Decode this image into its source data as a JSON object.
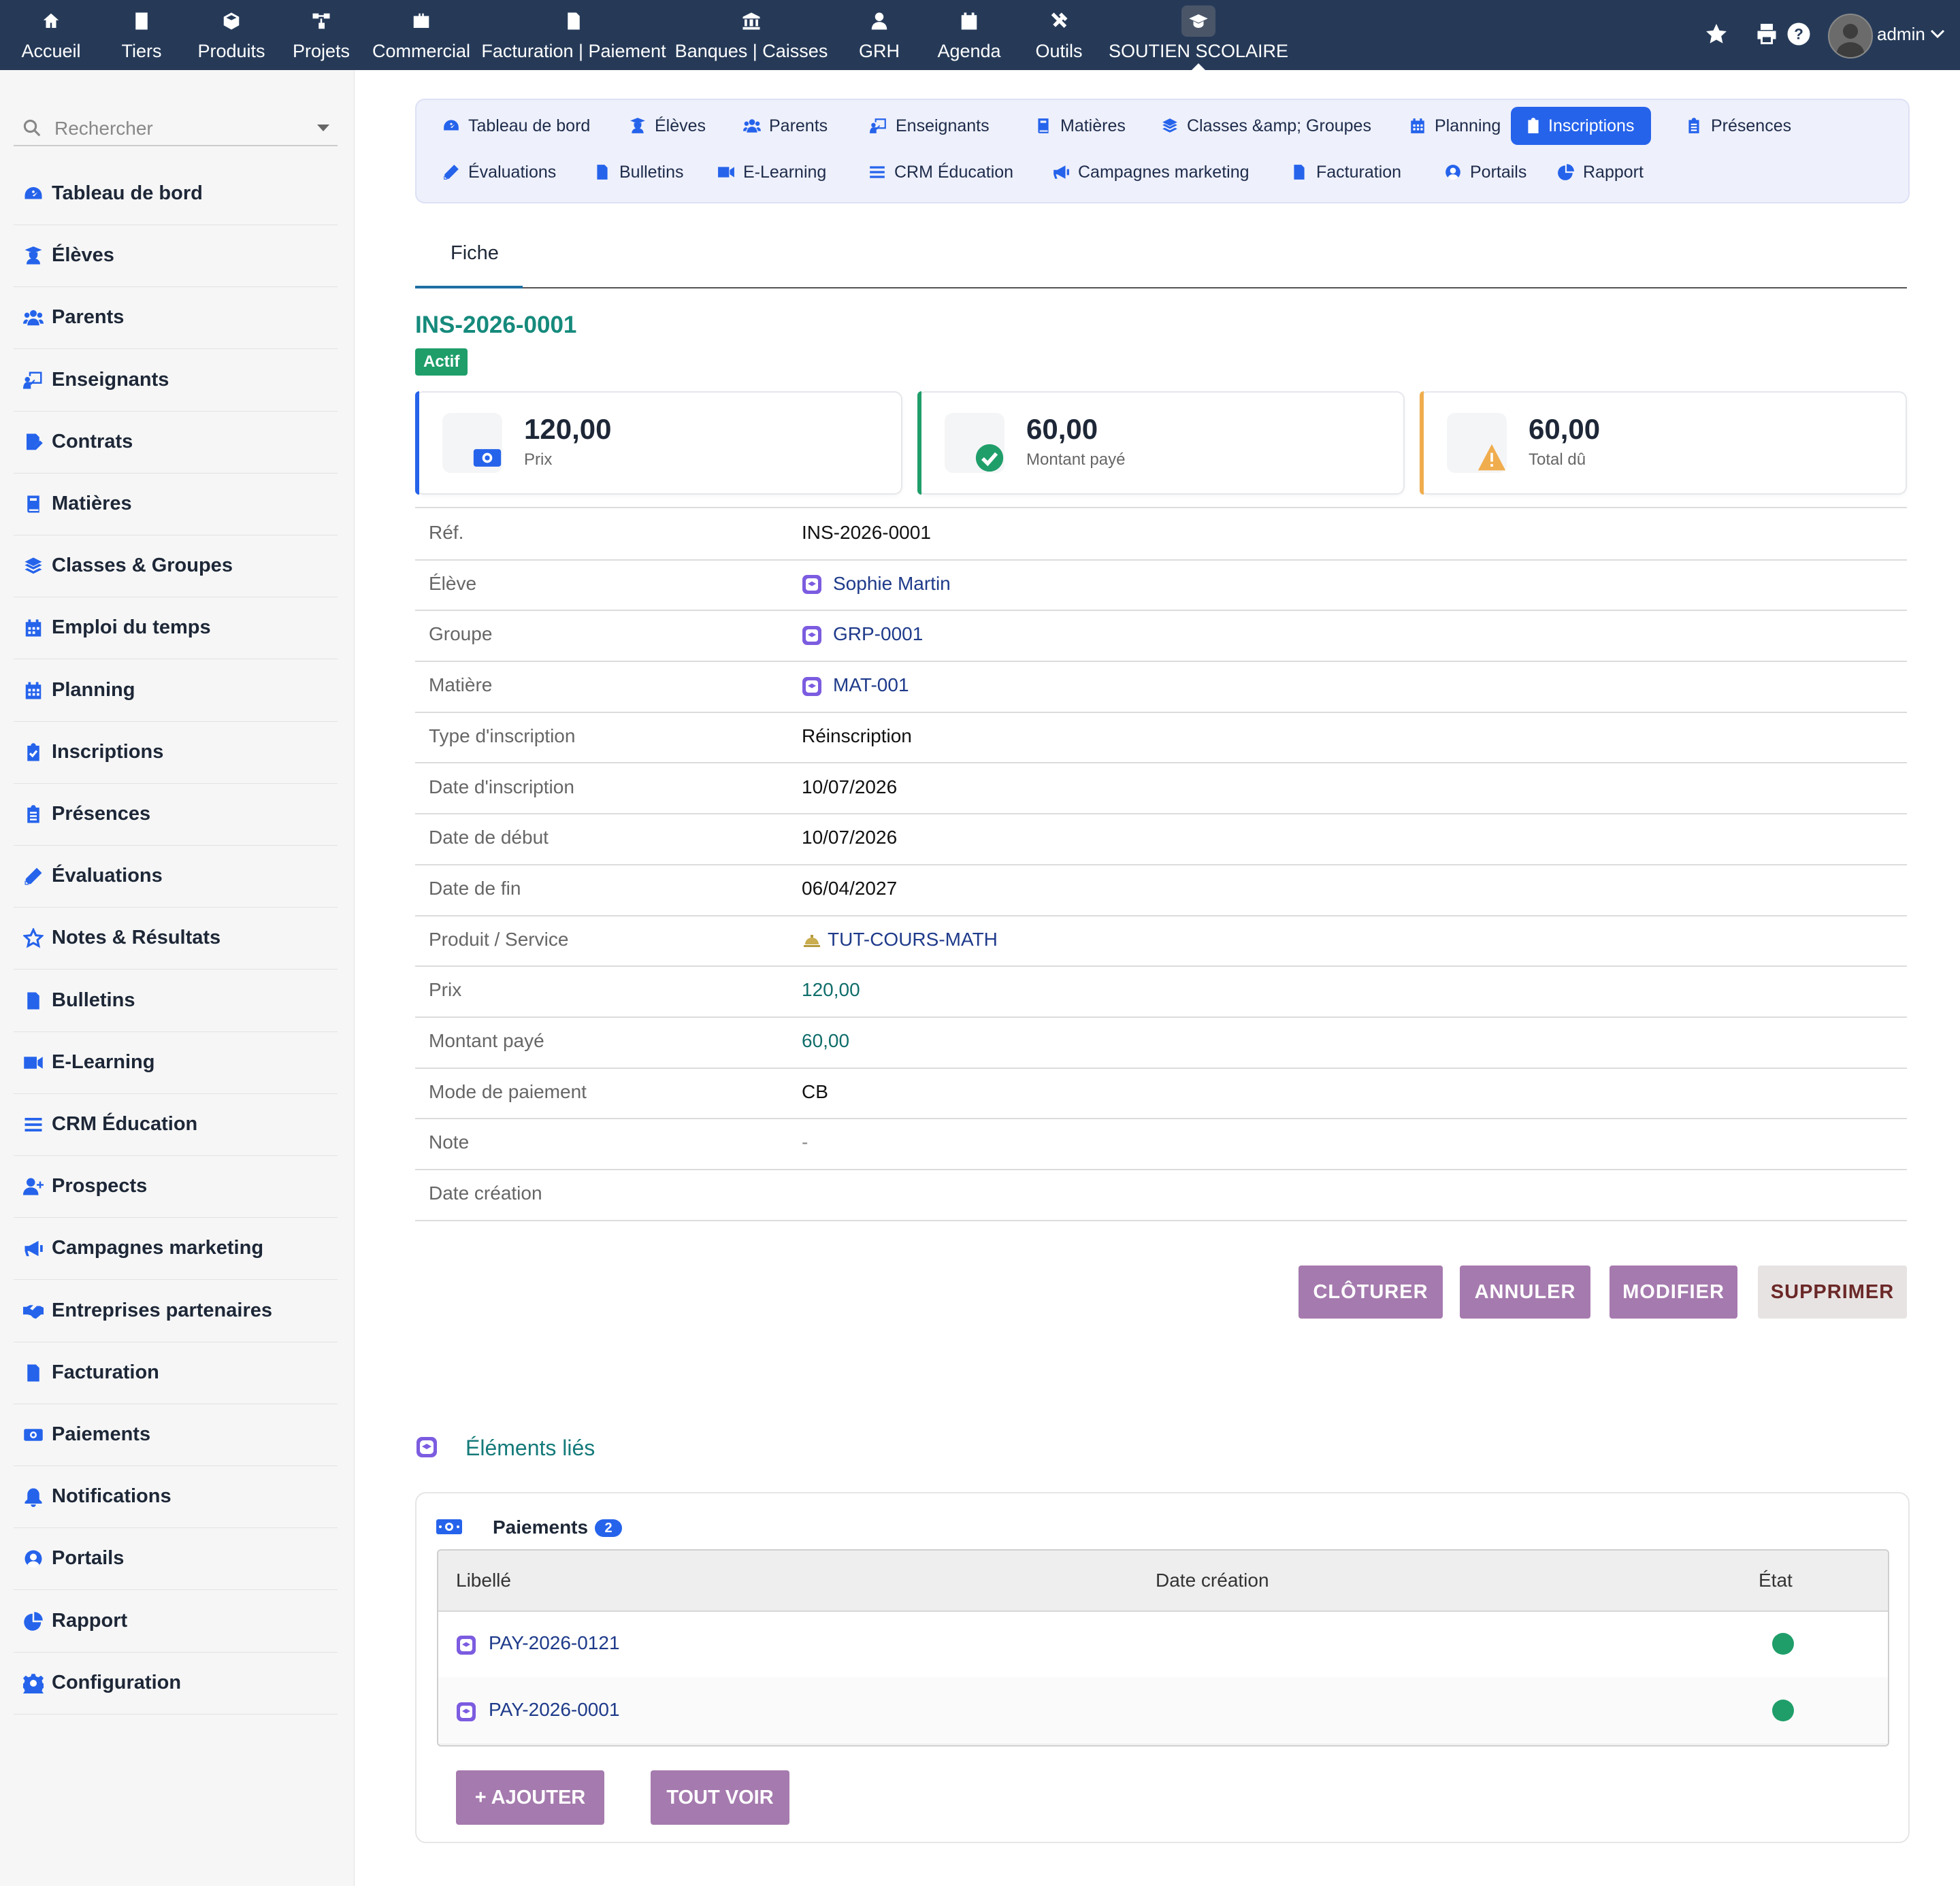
{
  "topnav": {
    "items": [
      {
        "label": "Accueil",
        "icon": "home-icon"
      },
      {
        "label": "Tiers",
        "icon": "building-icon"
      },
      {
        "label": "Produits",
        "icon": "cube-icon"
      },
      {
        "label": "Projets",
        "icon": "sitemap-icon"
      },
      {
        "label": "Commercial",
        "icon": "briefcase-icon"
      },
      {
        "label": "Facturation | Paiement",
        "icon": "invoice-icon"
      },
      {
        "label": "Banques | Caisses",
        "icon": "bank-icon"
      },
      {
        "label": "GRH",
        "icon": "user-tie-icon"
      },
      {
        "label": "Agenda",
        "icon": "calendar-icon"
      },
      {
        "label": "Outils",
        "icon": "tools-icon"
      },
      {
        "label": "SOUTIEN SCOLAIRE",
        "icon": "graduation-cap-icon"
      }
    ],
    "active_index": 10,
    "username": "admin"
  },
  "sidebar": {
    "search_placeholder": "Rechercher",
    "items": [
      {
        "label": "Tableau de bord",
        "icon": "dashboard-icon"
      },
      {
        "label": "Élèves",
        "icon": "student-icon"
      },
      {
        "label": "Parents",
        "icon": "users-icon"
      },
      {
        "label": "Enseignants",
        "icon": "teacher-icon"
      },
      {
        "label": "Contrats",
        "icon": "contract-icon"
      },
      {
        "label": "Matières",
        "icon": "book-icon"
      },
      {
        "label": "Classes & Groupes",
        "icon": "layers-icon"
      },
      {
        "label": "Emploi du temps",
        "icon": "calendar-icon"
      },
      {
        "label": "Planning",
        "icon": "calendar-grid-icon"
      },
      {
        "label": "Inscriptions",
        "icon": "clipboard-check-icon"
      },
      {
        "label": "Présences",
        "icon": "clipboard-list-icon"
      },
      {
        "label": "Évaluations",
        "icon": "pencil-icon"
      },
      {
        "label": "Notes & Résultats",
        "icon": "star-icon"
      },
      {
        "label": "Bulletins",
        "icon": "file-icon"
      },
      {
        "label": "E-Learning",
        "icon": "video-icon"
      },
      {
        "label": "CRM Éducation",
        "icon": "list-icon"
      },
      {
        "label": "Prospects",
        "icon": "user-plus-icon"
      },
      {
        "label": "Campagnes marketing",
        "icon": "megaphone-icon"
      },
      {
        "label": "Entreprises partenaires",
        "icon": "handshake-icon"
      },
      {
        "label": "Facturation",
        "icon": "invoice-icon"
      },
      {
        "label": "Paiements",
        "icon": "money-icon"
      },
      {
        "label": "Notifications",
        "icon": "bell-icon"
      },
      {
        "label": "Portails",
        "icon": "user-circle-icon"
      },
      {
        "label": "Rapport",
        "icon": "pie-chart-icon"
      },
      {
        "label": "Configuration",
        "icon": "gear-icon"
      }
    ]
  },
  "subnav": {
    "row1": [
      {
        "label": "Tableau de bord",
        "icon": "dashboard-icon"
      },
      {
        "label": "Élèves",
        "icon": "student-icon"
      },
      {
        "label": "Parents",
        "icon": "users-icon"
      },
      {
        "label": "Enseignants",
        "icon": "teacher-icon"
      },
      {
        "label": "Matières",
        "icon": "book-icon"
      },
      {
        "label": "Classes &amp; Groupes",
        "icon": "layers-icon"
      },
      {
        "label": "Planning",
        "icon": "calendar-grid-icon"
      },
      {
        "label": "Inscriptions",
        "icon": "clipboard-check-icon"
      },
      {
        "label": "Présences",
        "icon": "clipboard-list-icon"
      }
    ],
    "row2": [
      {
        "label": "Évaluations",
        "icon": "pencil-icon"
      },
      {
        "label": "Bulletins",
        "icon": "file-icon"
      },
      {
        "label": "E-Learning",
        "icon": "video-icon"
      },
      {
        "label": "CRM Éducation",
        "icon": "list-icon"
      },
      {
        "label": "Campagnes marketing",
        "icon": "megaphone-icon"
      },
      {
        "label": "Facturation",
        "icon": "invoice-icon"
      },
      {
        "label": "Portails",
        "icon": "user-circle-icon"
      },
      {
        "label": "Rapport",
        "icon": "pie-chart-icon"
      }
    ],
    "active": "Inscriptions"
  },
  "tab": {
    "label": "Fiche"
  },
  "record": {
    "title": "INS-2026-0001",
    "status": "Actif",
    "status_color": "#1f9e6a"
  },
  "cards": [
    {
      "value": "120,00",
      "label": "Prix",
      "icon": "money-icon",
      "color": "#2563eb"
    },
    {
      "value": "60,00",
      "label": "Montant payé",
      "icon": "check-circle-icon",
      "color": "#1f9e6a"
    },
    {
      "value": "60,00",
      "label": "Total dû",
      "icon": "warning-icon",
      "color": "#f0ad4e"
    }
  ],
  "details": [
    {
      "key": "Réf.",
      "value": "INS-2026-0001",
      "kind": "text"
    },
    {
      "key": "Élève",
      "value": "Sophie Martin",
      "kind": "link"
    },
    {
      "key": "Groupe",
      "value": "GRP-0001",
      "kind": "link"
    },
    {
      "key": "Matière",
      "value": "MAT-001",
      "kind": "link"
    },
    {
      "key": "Type d'inscription",
      "value": "Réinscription",
      "kind": "text"
    },
    {
      "key": "Date d'inscription",
      "value": "10/07/2026",
      "kind": "text"
    },
    {
      "key": "Date de début",
      "value": "10/07/2026",
      "kind": "text"
    },
    {
      "key": "Date de fin",
      "value": "06/04/2027",
      "kind": "text"
    },
    {
      "key": "Produit / Service",
      "value": "TUT-COURS-MATH",
      "kind": "service"
    },
    {
      "key": "Prix",
      "value": "120,00",
      "kind": "amount"
    },
    {
      "key": "Montant payé",
      "value": "60,00",
      "kind": "amount"
    },
    {
      "key": "Mode de paiement",
      "value": "CB",
      "kind": "text"
    },
    {
      "key": "Note",
      "value": "-",
      "kind": "muted"
    },
    {
      "key": "Date création",
      "value": "",
      "kind": "text"
    }
  ],
  "actions": {
    "close": "CLÔTURER",
    "cancel": "ANNULER",
    "edit": "MODIFIER",
    "delete": "SUPPRIMER"
  },
  "linked": {
    "title": "Éléments liés",
    "panel_title": "Paiements",
    "count": "2",
    "columns": [
      "Libellé",
      "Date création",
      "État"
    ],
    "rows": [
      {
        "label": "PAY-2026-0121",
        "date": "",
        "state_color": "#1f9e6a"
      },
      {
        "label": "PAY-2026-0001",
        "date": "",
        "state_color": "#1f9e6a"
      }
    ],
    "add_label": "AJOUTER",
    "add_icon": "+",
    "all_label": "TOUT VOIR"
  }
}
